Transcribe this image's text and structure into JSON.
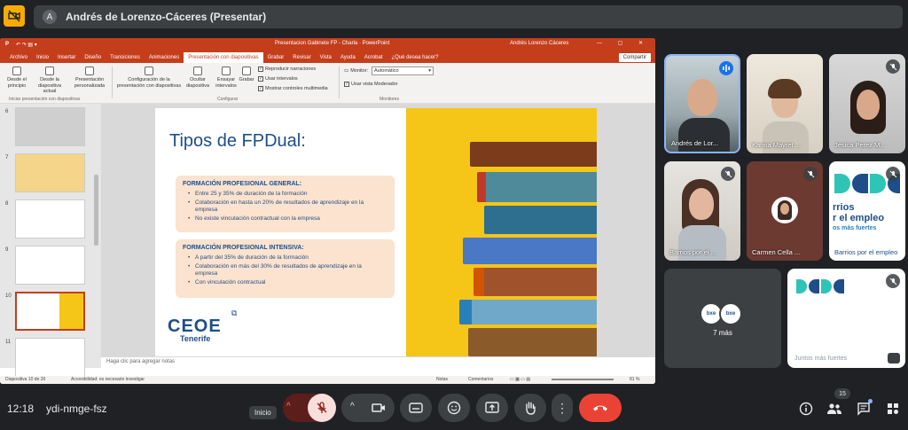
{
  "top": {
    "presenter_initial": "A",
    "presenting_label": "Andrés de Lorenzo-Cáceres (Presentar)"
  },
  "ppt": {
    "window_title": "Presentacion Gabinete FP - Charla · PowerPoint",
    "user_name": "Andrés Lorenzo Cáceres",
    "tabs": [
      "Archivo",
      "Inicio",
      "Insertar",
      "Diseño",
      "Transiciones",
      "Animaciones",
      "Presentación con diapositivas",
      "Grabar",
      "Revisar",
      "Vista",
      "Ayuda",
      "Acrobat",
      "¿Qué desea hacer?"
    ],
    "active_tab_index": 6,
    "share_label": "Compartir",
    "ribbon": {
      "btn_start": "Desde el principio",
      "btn_current": "Desde la diapositiva actual",
      "btn_custom": "Presentación personalizada",
      "group_start": "Iniciar presentación con diapositivas",
      "btn_setup": "Configuración de la presentación con diapositivas",
      "btn_hide": "Ocultar diapositiva",
      "btn_rehearse": "Ensayar intervalos",
      "btn_record": "Grabar",
      "chk_narr": "Reproducir narraciones",
      "chk_timings": "Usar intervalos",
      "chk_controls": "Mostrar controles multimedia",
      "group_config": "Configurar",
      "monitor_label": "Monitor:",
      "monitor_value": "Automático",
      "presenter_view": "Usar vista Moderador",
      "group_monitors": "Monitores"
    },
    "thumb_numbers": [
      "6",
      "7",
      "8",
      "9",
      "10",
      "11"
    ],
    "slide": {
      "title": "Tipos de FPDual:",
      "box1_heading": "FORMACIÓN PROFESIONAL GENERAL:",
      "box1_items": [
        "Entre 25 y 35% de duración de la formación",
        "Colaboración en hasta un 20% de resultados de aprendizaje en la empresa",
        "No existe vinculación contractual con la empresa"
      ],
      "box2_heading": "FORMACIÓN PROFESIONAL INTENSIVA:",
      "box2_items": [
        "A partir del 35% de duración de la formación",
        "Colaboración en más del 30% de resultados de aprendizaje en la empresa",
        "Con vinculación contractual"
      ],
      "logo_main": "CEOE",
      "logo_sub": "Tenerife"
    },
    "notes_placeholder": "Haga clic para agregar notas",
    "status": {
      "slide_count": "Diapositiva 10 de 20",
      "accessibility": "Accesibilidad: es necesario investigar",
      "notes": "Notas",
      "comments": "Comentarios",
      "zoom": "81 %"
    }
  },
  "participants": [
    {
      "name": "Andrés de Lor...",
      "speaking": true
    },
    {
      "name": "Karina Mayret ...",
      "muted": false
    },
    {
      "name": "Jesica Perez M...",
      "muted": true
    },
    {
      "name": "Barrios por el ...",
      "muted": true
    },
    {
      "name": "Carmen Cella ...",
      "muted": true
    },
    {
      "name": "Barrios por el empleo",
      "muted": true
    }
  ],
  "tile6_text": {
    "line1": "rrios",
    "line2": "r el empleo",
    "line3": "os más fuertes"
  },
  "more_label": "7 más",
  "juntos_label": "Juntos más fuertes",
  "bottom": {
    "time": "12:18",
    "code": "ydi-nmge-fsz",
    "tooltip": "Inicio",
    "participant_count": "15"
  },
  "colors": {
    "ppt_accent": "#c43e1c",
    "end_call": "#ea4335",
    "slide_title": "#1d4e89",
    "box_fill": "#fbe3cf"
  }
}
